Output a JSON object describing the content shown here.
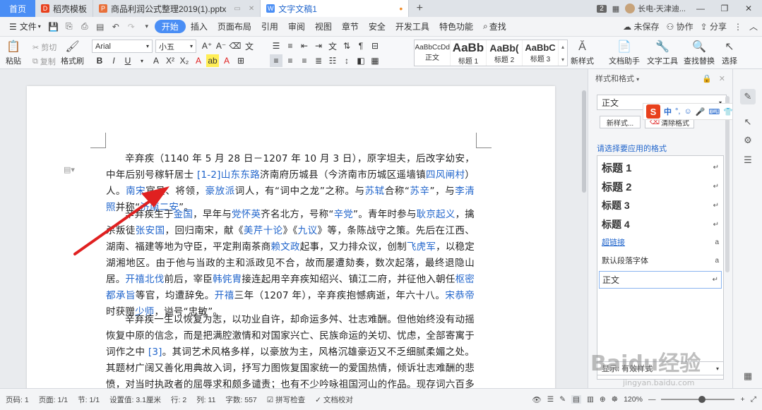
{
  "titlebar": {
    "home": "首页",
    "tabs": [
      {
        "label": "稻壳模板",
        "icon": "docer-icon",
        "color": "#e8401c"
      },
      {
        "label": "商品利润公式整理2019(1).pptx",
        "icon": "ppt-icon",
        "color": "#e8703a"
      },
      {
        "label": "文字文稿1",
        "icon": "word-icon",
        "color": "#4a8ef5"
      }
    ],
    "badge": "2",
    "user": "长电-天津迪..."
  },
  "menubar": {
    "file": "文件",
    "tabs": [
      "开始",
      "插入",
      "页面布局",
      "引用",
      "审阅",
      "视图",
      "章节",
      "安全",
      "开发工具",
      "特色功能"
    ],
    "search": "查找",
    "unsaved": "未保存",
    "collab": "协作",
    "share": "分享"
  },
  "ribbon": {
    "paste": "粘贴",
    "cut": "剪切",
    "copy": "复制",
    "format_painter": "格式刷",
    "font_name": "Arial",
    "font_size": "小五",
    "styles": [
      {
        "preview": "AaBbCcDd",
        "label": "正文"
      },
      {
        "preview": "AaBb",
        "label": "标题 1"
      },
      {
        "preview": "AaBb(",
        "label": "标题 2"
      },
      {
        "preview": "AaBbC",
        "label": "标题 3"
      }
    ],
    "new_style": "新样式",
    "assistant": "文档助手",
    "tools": "文字工具",
    "find_replace": "查找替换",
    "select": "选择"
  },
  "document": {
    "p1": {
      "pre": "辛弃疾（1140 年 5 月 28 日－1207 年 10 月 3 日），原字坦夫，后改字幼安，中年后别号稼轩居士 ",
      "ref": "[1-2]",
      "l1": "山东东路",
      "t1": "济南府历城县（今济南市历城区遥墙镇",
      "l2": "四风闸村",
      "t2": "）人。",
      "l3": "南宋",
      "t3": "官员、将领，",
      "l4": "豪放派",
      "t4": "词人，有“词中之龙”之称。与",
      "l5": "苏轼",
      "t5": "合称“",
      "l6": "苏辛",
      "t6": "”，与",
      "l7": "李清照",
      "t7": "并称“",
      "l8": "济南二安",
      "t8": "”。"
    },
    "p2": {
      "t0": "辛弃疾生于",
      "l1": "金国",
      "t1": "，早年与",
      "l2": "党怀英",
      "t2": "齐名北方，号称“",
      "l3": "辛党",
      "t3": "”。青年时参与",
      "l4": "耿京起义",
      "t4": "，擒杀叛徒",
      "l5": "张安国",
      "t5": "，回归南宋，献《",
      "l6": "美芹十论",
      "t6": "》《",
      "l7": "九议",
      "t7": "》等，条陈战守之策。先后在江西、湖南、福建等地为守臣，平定荆南茶商",
      "l8": "赖文政",
      "t8": "起事，又力排众议，创制",
      "l9": "飞虎军",
      "t9": "，以稳定湖湘地区。由于他与当政的主和派政见不合，故而屡遭劾奏，数次起落，最终退隐山居。",
      "l10": "开禧北伐",
      "t10": "前后，宰臣",
      "l11": "韩侂胄",
      "t11": "接连起用辛弃疾知绍兴、镇江二府，并征他入朝任",
      "l12": "枢密都承旨",
      "t12": "等官，均遭辞免。",
      "l13": "开禧",
      "t13": "三年（1207 年），辛弃疾抱憾病逝，年六十八。",
      "l14": "宋恭帝",
      "t14": "时获赠",
      "l15": "少师",
      "t15": "，谥号“忠敏”。"
    },
    "p3": {
      "t0": "辛弃疾一生以恢复为志，以功业自许，却命运多舛、壮志难酬。但他始终没有动摇恢复中原的信念，而是把满腔激情和对国家兴亡、民族命运的关切、忧虑，全部寄寓于词作之中 ",
      "ref": "[3]",
      "t1": "。其词艺术风格多样，以豪放为主，风格沉雄豪迈又不乏细腻柔媚之处。其题材广阔又善化用典故入词，抒写力图恢复国家统一的爱国热情，倾诉壮志难酬的悲愤，对当时执政者的屈辱求和颇多谴责；也有不少吟咏祖国河山的作品。现存词六百多首，有词集《",
      "l1": "稼轩"
    }
  },
  "panel": {
    "title": "样式和格式",
    "current": "正文",
    "new_style": "新样式...",
    "clear": "清除格式",
    "apply_label": "请选择要应用的格式",
    "items": [
      "标题 1",
      "标题 2",
      "标题 3",
      "标题 4",
      "超链接",
      "默认段落字体",
      "正文"
    ],
    "show_label": "显示",
    "show_value": "有效样式"
  },
  "ime": {
    "logo": "S",
    "mode": "中"
  },
  "statusbar": {
    "page": "页码: 1",
    "pages": "页面: 1/1",
    "section": "节: 1/1",
    "position": "设置值: 3.1厘米",
    "row": "行: 2",
    "col": "列: 11",
    "words": "字数: 557",
    "spell": "拼写检查",
    "proof": "文档校对",
    "zoom": "120%",
    "zoom_level": 0.55
  },
  "watermark": {
    "brand": "Baidu经验",
    "url": "jingyan.baidu.com"
  },
  "colors": {
    "accent": "#4a8ef5",
    "link": "#2266cc",
    "arrow": "#e02020"
  }
}
